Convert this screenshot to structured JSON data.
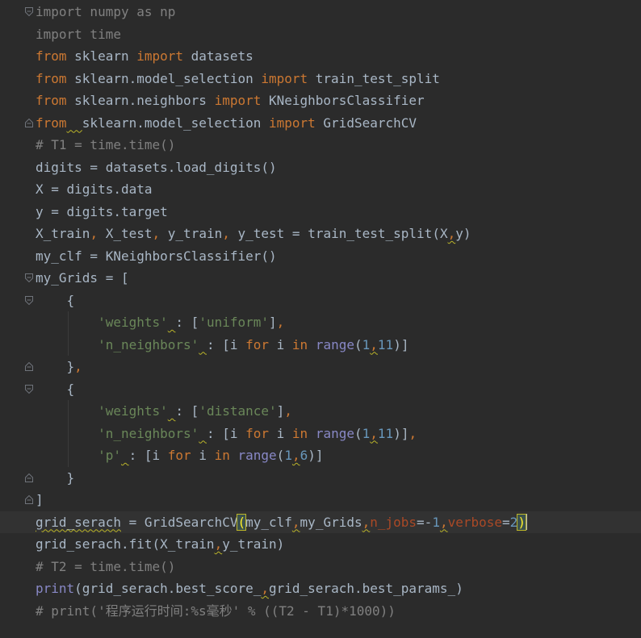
{
  "editor": {
    "lines": [
      {
        "fold": "open",
        "tokens": [
          {
            "t": "import",
            "c": "faded"
          },
          {
            "t": " numpy ",
            "c": "faded"
          },
          {
            "t": "as",
            "c": "faded"
          },
          {
            "t": " np",
            "c": "faded"
          }
        ]
      },
      {
        "fold": "",
        "tokens": [
          {
            "t": "import",
            "c": "faded"
          },
          {
            "t": " time",
            "c": "faded"
          }
        ]
      },
      {
        "fold": "",
        "tokens": [
          {
            "t": "from",
            "c": "kw"
          },
          {
            "t": " sklearn ",
            "c": "id"
          },
          {
            "t": "import",
            "c": "kw"
          },
          {
            "t": " datasets",
            "c": "id"
          }
        ]
      },
      {
        "fold": "",
        "tokens": [
          {
            "t": "from",
            "c": "kw"
          },
          {
            "t": " sklearn.model_selection ",
            "c": "id"
          },
          {
            "t": "import",
            "c": "kw"
          },
          {
            "t": " train_test_split",
            "c": "id"
          }
        ]
      },
      {
        "fold": "",
        "tokens": [
          {
            "t": "from",
            "c": "kw"
          },
          {
            "t": " sklearn.neighbors ",
            "c": "id"
          },
          {
            "t": "import",
            "c": "kw"
          },
          {
            "t": " KNeighborsClassifier",
            "c": "id"
          }
        ]
      },
      {
        "fold": "close",
        "tokens": [
          {
            "t": "from",
            "c": "kw"
          },
          {
            "t": "  ",
            "c": "id warn"
          },
          {
            "t": "sklearn.model_selection ",
            "c": "id"
          },
          {
            "t": "import",
            "c": "kw"
          },
          {
            "t": " GridSearchCV",
            "c": "id"
          }
        ]
      },
      {
        "fold": "",
        "tokens": [
          {
            "t": "# T1 = time.time()",
            "c": "cm"
          }
        ]
      },
      {
        "fold": "",
        "tokens": [
          {
            "t": "digits = datasets.load_digits()",
            "c": "id"
          }
        ]
      },
      {
        "fold": "",
        "tokens": [
          {
            "t": "X = digits.data",
            "c": "id"
          }
        ]
      },
      {
        "fold": "",
        "tokens": [
          {
            "t": "y = digits.target",
            "c": "id"
          }
        ]
      },
      {
        "fold": "",
        "tokens": [
          {
            "t": "X_train",
            "c": "id"
          },
          {
            "t": ",",
            "c": "op"
          },
          {
            "t": " X_test",
            "c": "id"
          },
          {
            "t": ",",
            "c": "op"
          },
          {
            "t": " y_train",
            "c": "id"
          },
          {
            "t": ",",
            "c": "op"
          },
          {
            "t": " y_test = train_test_split(X",
            "c": "id"
          },
          {
            "t": ",",
            "c": "op warn"
          },
          {
            "t": "y)",
            "c": "id"
          }
        ]
      },
      {
        "fold": "",
        "tokens": [
          {
            "t": "my_clf = KNeighborsClassifier()",
            "c": "id"
          }
        ]
      },
      {
        "fold": "open",
        "tokens": [
          {
            "t": "my_Grids = [",
            "c": "id"
          }
        ]
      },
      {
        "fold": "open",
        "tokens": [
          {
            "t": "    {",
            "c": "id"
          }
        ]
      },
      {
        "fold": "",
        "tokens": [
          {
            "t": "        ",
            "c": "id"
          },
          {
            "t": "'weights'",
            "c": "str"
          },
          {
            "t": " ",
            "c": "id warn"
          },
          {
            "t": ": [",
            "c": "id"
          },
          {
            "t": "'uniform'",
            "c": "str"
          },
          {
            "t": "]",
            "c": "id"
          },
          {
            "t": ",",
            "c": "op"
          }
        ]
      },
      {
        "fold": "",
        "tokens": [
          {
            "t": "        ",
            "c": "id"
          },
          {
            "t": "'n_neighbors'",
            "c": "str"
          },
          {
            "t": " ",
            "c": "id warn"
          },
          {
            "t": ": [i ",
            "c": "id"
          },
          {
            "t": "for",
            "c": "kw"
          },
          {
            "t": " i ",
            "c": "id"
          },
          {
            "t": "in",
            "c": "kw"
          },
          {
            "t": " ",
            "c": "id"
          },
          {
            "t": "range",
            "c": "bi"
          },
          {
            "t": "(",
            "c": "id"
          },
          {
            "t": "1",
            "c": "num"
          },
          {
            "t": ",",
            "c": "op warn"
          },
          {
            "t": "11",
            "c": "num"
          },
          {
            "t": ")]",
            "c": "id"
          }
        ]
      },
      {
        "fold": "close",
        "tokens": [
          {
            "t": "    }",
            "c": "id"
          },
          {
            "t": ",",
            "c": "op"
          }
        ]
      },
      {
        "fold": "open",
        "tokens": [
          {
            "t": "    {",
            "c": "id"
          }
        ]
      },
      {
        "fold": "",
        "tokens": [
          {
            "t": "        ",
            "c": "id"
          },
          {
            "t": "'weights'",
            "c": "str"
          },
          {
            "t": " ",
            "c": "id warn"
          },
          {
            "t": ": [",
            "c": "id"
          },
          {
            "t": "'distance'",
            "c": "str"
          },
          {
            "t": "]",
            "c": "id"
          },
          {
            "t": ",",
            "c": "op"
          }
        ]
      },
      {
        "fold": "",
        "tokens": [
          {
            "t": "        ",
            "c": "id"
          },
          {
            "t": "'n_neighbors'",
            "c": "str"
          },
          {
            "t": " ",
            "c": "id warn"
          },
          {
            "t": ": [i ",
            "c": "id"
          },
          {
            "t": "for",
            "c": "kw"
          },
          {
            "t": " i ",
            "c": "id"
          },
          {
            "t": "in",
            "c": "kw"
          },
          {
            "t": " ",
            "c": "id"
          },
          {
            "t": "range",
            "c": "bi"
          },
          {
            "t": "(",
            "c": "id"
          },
          {
            "t": "1",
            "c": "num"
          },
          {
            "t": ",",
            "c": "op warn"
          },
          {
            "t": "11",
            "c": "num"
          },
          {
            "t": ")]",
            "c": "id"
          },
          {
            "t": ",",
            "c": "op"
          }
        ]
      },
      {
        "fold": "",
        "tokens": [
          {
            "t": "        ",
            "c": "id"
          },
          {
            "t": "'p'",
            "c": "str"
          },
          {
            "t": " ",
            "c": "id warn"
          },
          {
            "t": ": [i ",
            "c": "id"
          },
          {
            "t": "for",
            "c": "kw"
          },
          {
            "t": " i ",
            "c": "id"
          },
          {
            "t": "in",
            "c": "kw"
          },
          {
            "t": " ",
            "c": "id"
          },
          {
            "t": "range",
            "c": "bi"
          },
          {
            "t": "(",
            "c": "id"
          },
          {
            "t": "1",
            "c": "num"
          },
          {
            "t": ",",
            "c": "op warn"
          },
          {
            "t": "6",
            "c": "num"
          },
          {
            "t": ")]",
            "c": "id"
          }
        ]
      },
      {
        "fold": "close",
        "tokens": [
          {
            "t": "    }",
            "c": "id"
          }
        ]
      },
      {
        "fold": "close",
        "tokens": [
          {
            "t": "]",
            "c": "id"
          }
        ]
      },
      {
        "fold": "",
        "current": true,
        "tokens": [
          {
            "t": "grid_serach",
            "c": "id warn"
          },
          {
            "t": " = GridSearchCV",
            "c": "id"
          },
          {
            "t": "(",
            "c": "id bracket-hl"
          },
          {
            "t": "my_clf",
            "c": "id"
          },
          {
            "t": ",",
            "c": "op warn"
          },
          {
            "t": "my_Grids",
            "c": "id"
          },
          {
            "t": ",",
            "c": "op warn"
          },
          {
            "t": "n_jobs",
            "c": "param"
          },
          {
            "t": "=-",
            "c": "id"
          },
          {
            "t": "1",
            "c": "num"
          },
          {
            "t": ",",
            "c": "op warn"
          },
          {
            "t": "verbose",
            "c": "param"
          },
          {
            "t": "=",
            "c": "id"
          },
          {
            "t": "2",
            "c": "num"
          },
          {
            "t": ")",
            "c": "id bracket-hl"
          }
        ]
      },
      {
        "fold": "",
        "tokens": [
          {
            "t": "grid_serach.fit(X_train",
            "c": "id"
          },
          {
            "t": ",",
            "c": "op warn"
          },
          {
            "t": "y_train)",
            "c": "id"
          }
        ]
      },
      {
        "fold": "",
        "tokens": [
          {
            "t": "# T2 = time.time()",
            "c": "cm"
          }
        ]
      },
      {
        "fold": "",
        "tokens": [
          {
            "t": "print",
            "c": "bi"
          },
          {
            "t": "(grid_serach.best_score_",
            "c": "id"
          },
          {
            "t": ",",
            "c": "op warn"
          },
          {
            "t": "grid_serach.best_params_)",
            "c": "id"
          }
        ]
      },
      {
        "fold": "",
        "tokens": [
          {
            "t": "# print('程序运行时间:%s毫秒' % ((T2 - T1)*1000))",
            "c": "cm"
          }
        ]
      }
    ]
  }
}
